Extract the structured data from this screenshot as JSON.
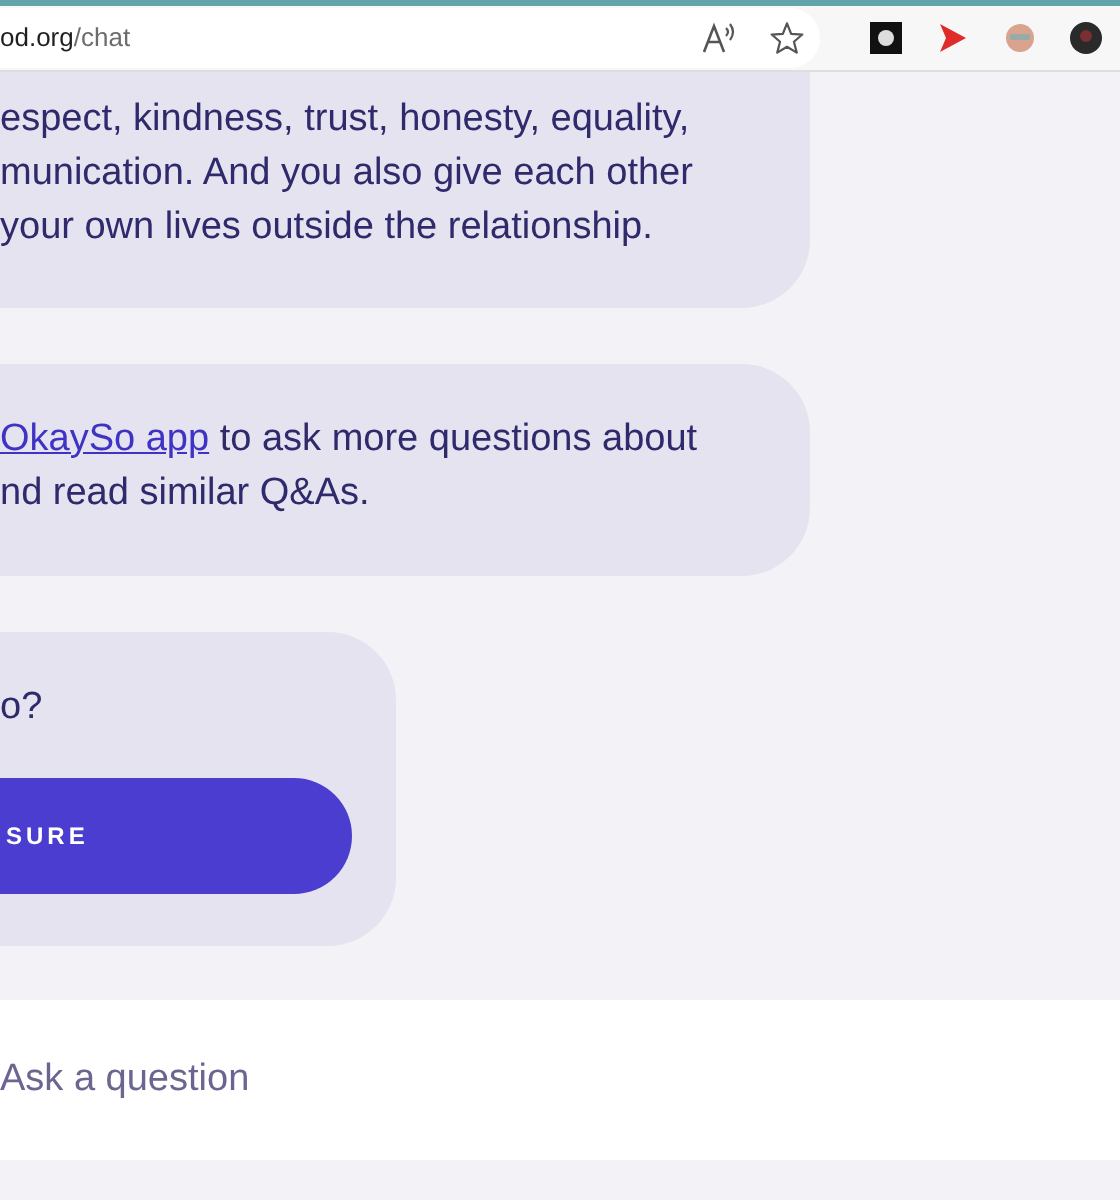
{
  "browser": {
    "url_host": "od.org",
    "url_path": "/chat",
    "extensions": [
      {
        "kind": "square"
      },
      {
        "kind": "play"
      },
      {
        "kind": "face"
      },
      {
        "kind": "avatar"
      }
    ]
  },
  "messages": [
    {
      "lines": [
        [
          "espect, kindness, trust, honesty, equality,"
        ],
        [
          "munication. And you also give each other"
        ],
        [
          "your own lives outside the relationship."
        ]
      ]
    },
    {
      "lines": [
        [
          {
            "link": "OkaySo app"
          },
          " to ask more questions about"
        ],
        [
          "nd read similar Q&As."
        ]
      ]
    },
    {
      "lines": [
        [
          "o?"
        ]
      ],
      "button": "SURE"
    }
  ],
  "composer": {
    "placeholder": "Ask a question"
  }
}
